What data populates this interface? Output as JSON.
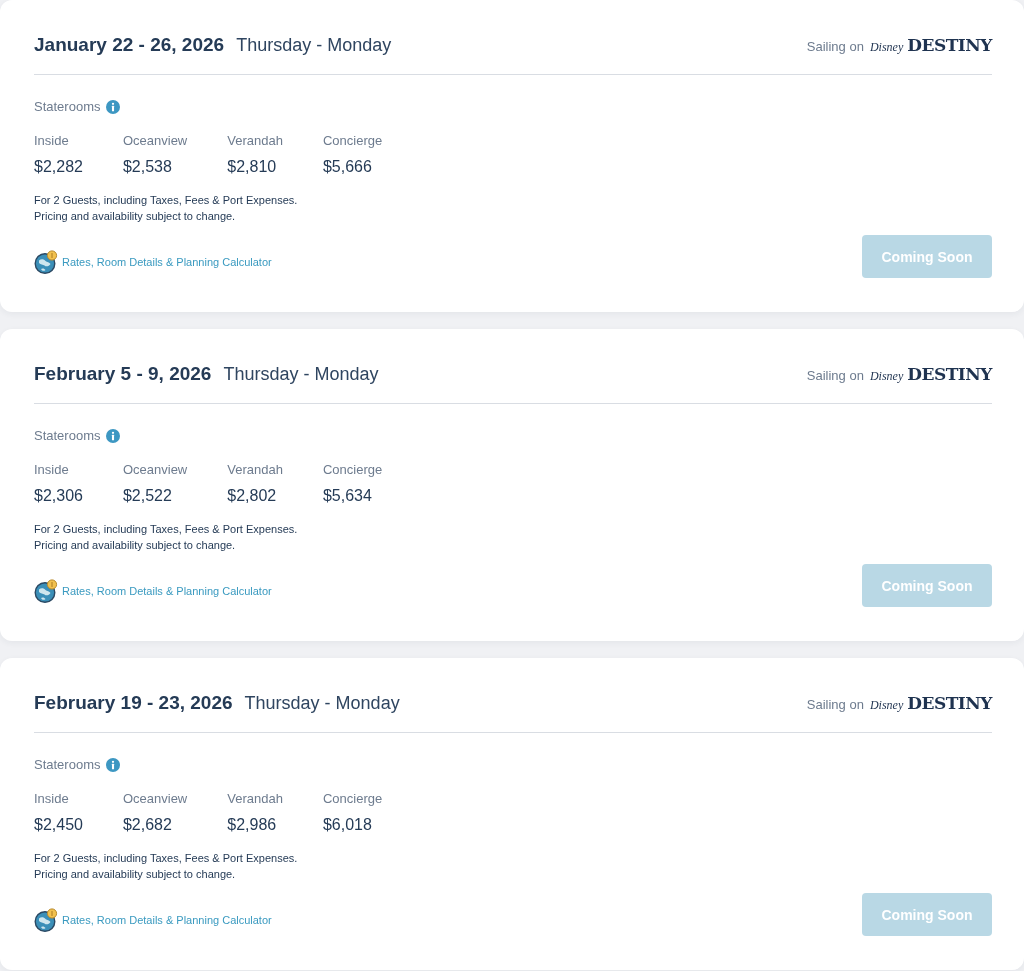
{
  "sailings": [
    {
      "dates": "January 22 - 26, 2026",
      "days": "Thursday - Monday",
      "ship": {
        "prefix": "Sailing on",
        "logo_brand": "Disney",
        "logo_name": "DESTINY"
      },
      "staterooms": {
        "label": "Staterooms",
        "categories": [
          {
            "name": "Inside",
            "price": "$2,282"
          },
          {
            "name": "Oceanview",
            "price": "$2,538"
          },
          {
            "name": "Verandah",
            "price": "$2,810"
          },
          {
            "name": "Concierge",
            "price": "$5,666"
          }
        ]
      },
      "notes": [
        "For 2 Guests, including Taxes, Fees & Port Expenses.",
        "Pricing and availability subject to change."
      ],
      "link": "Rates, Room Details & Planning Calculator",
      "button": {
        "label": "Coming Soon",
        "disabled": true
      }
    },
    {
      "dates": "February 5 - 9, 2026",
      "days": "Thursday - Monday",
      "ship": {
        "prefix": "Sailing on",
        "logo_brand": "Disney",
        "logo_name": "DESTINY"
      },
      "staterooms": {
        "label": "Staterooms",
        "categories": [
          {
            "name": "Inside",
            "price": "$2,306"
          },
          {
            "name": "Oceanview",
            "price": "$2,522"
          },
          {
            "name": "Verandah",
            "price": "$2,802"
          },
          {
            "name": "Concierge",
            "price": "$5,634"
          }
        ]
      },
      "notes": [
        "For 2 Guests, including Taxes, Fees & Port Expenses.",
        "Pricing and availability subject to change."
      ],
      "link": "Rates, Room Details & Planning Calculator",
      "button": {
        "label": "Coming Soon",
        "disabled": true
      }
    },
    {
      "dates": "February 19 - 23, 2026",
      "days": "Thursday - Monday",
      "ship": {
        "prefix": "Sailing on",
        "logo_brand": "Disney",
        "logo_name": "DESTINY"
      },
      "staterooms": {
        "label": "Staterooms",
        "categories": [
          {
            "name": "Inside",
            "price": "$2,450"
          },
          {
            "name": "Oceanview",
            "price": "$2,682"
          },
          {
            "name": "Verandah",
            "price": "$2,986"
          },
          {
            "name": "Concierge",
            "price": "$6,018"
          }
        ]
      },
      "notes": [
        "For 2 Guests, including Taxes, Fees & Port Expenses.",
        "Pricing and availability subject to change."
      ],
      "link": "Rates, Room Details & Planning Calculator",
      "button": {
        "label": "Coming Soon",
        "disabled": true
      }
    }
  ]
}
